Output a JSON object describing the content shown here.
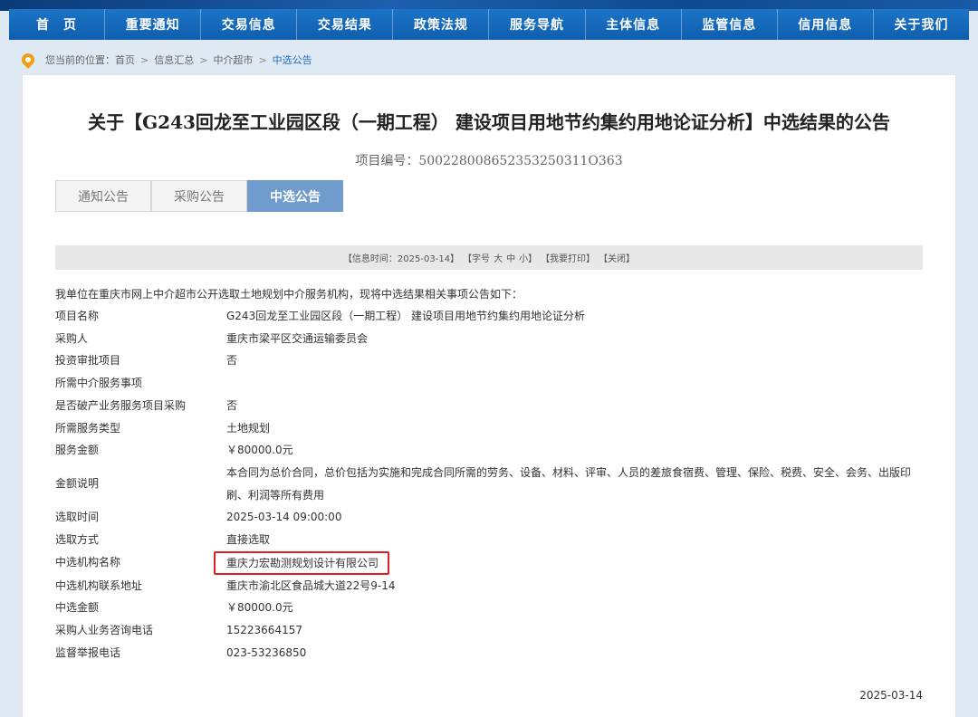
{
  "nav": {
    "items": [
      "首　页",
      "重要通知",
      "交易信息",
      "交易结果",
      "政策法规",
      "服务导航",
      "主体信息",
      "监管信息",
      "信用信息",
      "关于我们"
    ]
  },
  "breadcrumb": {
    "prefix": "您当前的位置：",
    "items": [
      "首页",
      "信息汇总",
      "中介超市"
    ],
    "current": "中选公告",
    "separator": ">"
  },
  "article": {
    "title": "关于【G243回龙至工业园区段（一期工程） 建设项目用地节约集约用地论证分析】中选结果的公告",
    "project_no": "项目编号：500228008652353250311O363",
    "tabs": [
      "通知公告",
      "采购公告",
      "中选公告"
    ],
    "active_tab": "中选公告",
    "info_bar": {
      "time": "【信息时间：2025-03-14】",
      "font_prefix": "【字号",
      "font_large": "大",
      "font_medium": "中",
      "font_small": "小】",
      "print": "【我要打印】",
      "close": "【关闭】"
    },
    "intro": "我单位在重庆市网上中介超市公开选取土地规划中介服务机构，现将中选结果相关事项公告如下：",
    "rows": [
      {
        "label": "项目名称",
        "value": "G243回龙至工业园区段（一期工程） 建设项目用地节约集约用地论证分析"
      },
      {
        "label": "采购人",
        "value": "重庆市梁平区交通运输委员会"
      },
      {
        "label": "投资审批项目",
        "value": "否"
      },
      {
        "label": "所需中介服务事项",
        "value": ""
      },
      {
        "label": "是否破产业务服务项目采购",
        "value": "否"
      },
      {
        "label": "所需服务类型",
        "value": "土地规划"
      },
      {
        "label": "服务金额",
        "value": "￥80000.0元"
      },
      {
        "label": "金额说明",
        "value": "本合同为总价合同，总价包括为实施和完成合同所需的劳务、设备、材料、评审、人员的差旅食宿费、管理、保险、税费、安全、会务、出版印刷、利润等所有费用"
      },
      {
        "label": "选取时间",
        "value": "2025-03-14 09:00:00"
      },
      {
        "label": "选取方式",
        "value": "直接选取"
      },
      {
        "label": "中选机构名称",
        "value": "重庆力宏勘测规划设计有限公司"
      },
      {
        "label": "中选机构联系地址",
        "value": "重庆市渝北区食品城大道22号9-14"
      },
      {
        "label": "中选金额",
        "value": "￥80000.0元"
      },
      {
        "label": "采购人业务咨询电话",
        "value": "15223664157"
      },
      {
        "label": "监督举报电话",
        "value": "023-53236850"
      }
    ],
    "footer_date": "2025-03-14"
  },
  "colors": {
    "nav_bg": "#1467b8",
    "active_tab": "#6f9ccc",
    "highlight_border": "#e02020",
    "breadcrumb_current": "#1a6fc4"
  }
}
